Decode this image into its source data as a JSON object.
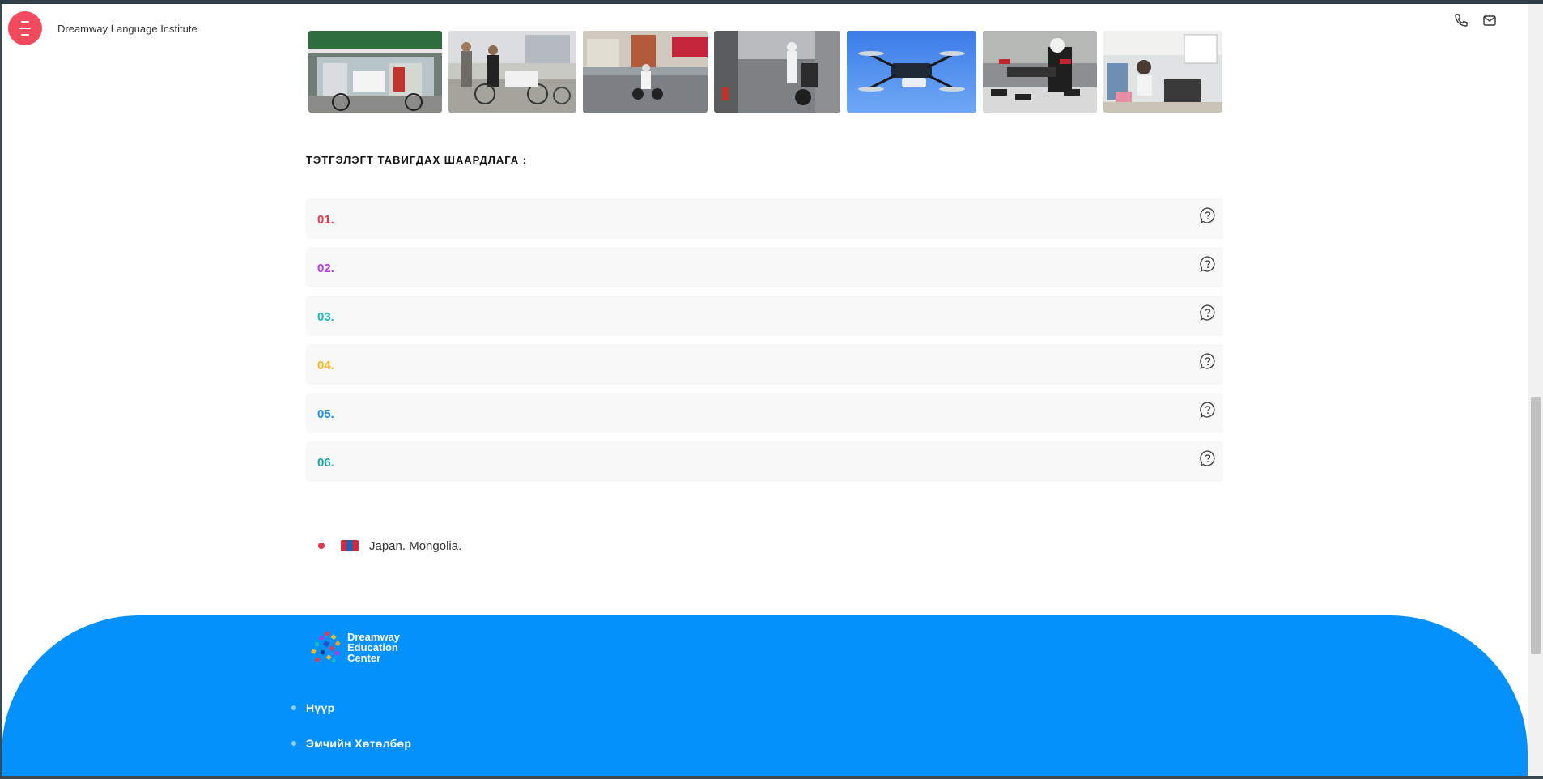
{
  "header": {
    "brand": "Dreamway Language Institute",
    "menu_icon": "hamburger-icon",
    "phone_icon": "phone-icon",
    "mail_icon": "mail-icon",
    "accent_color": "#f04a5c"
  },
  "gallery": {
    "photos": [
      "photo-store-delivery",
      "photo-bicycle-delivery",
      "photo-scooter-delivery",
      "photo-motorbike-delivery",
      "photo-drone",
      "photo-drone-technician",
      "photo-office-worker"
    ]
  },
  "requirements": {
    "title": "ТЭТГЭЛЭГТ ТАВИГДАХ ШААРДЛАГА :",
    "items": [
      {
        "number": "01.",
        "color": "#e8384f"
      },
      {
        "number": "02.",
        "color": "#b23bd6"
      },
      {
        "number": "03.",
        "color": "#1fb8b4"
      },
      {
        "number": "04.",
        "color": "#f2b92b"
      },
      {
        "number": "05.",
        "color": "#1e8fe0"
      },
      {
        "number": "06.",
        "color": "#1ba3a6"
      }
    ],
    "toggle_icon": "question-bubble-icon"
  },
  "countries": {
    "text": "Japan. Mongolia."
  },
  "footer": {
    "background": "#0491fb",
    "logo_lines": [
      "Dreamway",
      "Education",
      "Center"
    ],
    "links": [
      "Нүүр",
      "Эмчийн Хөтөлбөр"
    ]
  }
}
